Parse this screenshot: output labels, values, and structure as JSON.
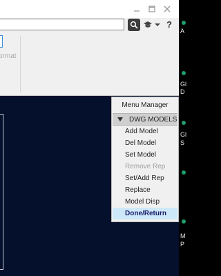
{
  "search": {
    "value": "",
    "placeholder": ""
  },
  "toolbar": {
    "help_label": "?"
  },
  "ribbon": {
    "format_label": "ormat"
  },
  "menu_manager": {
    "title": "Menu Manager",
    "section": "DWG MODELS",
    "items": [
      {
        "label": "Add Model",
        "enabled": true
      },
      {
        "label": "Del Model",
        "enabled": true
      },
      {
        "label": "Set Model",
        "enabled": true
      },
      {
        "label": "Remove Rep",
        "enabled": false
      },
      {
        "label": "Set/Add Rep",
        "enabled": true
      },
      {
        "label": "Replace",
        "enabled": true
      },
      {
        "label": "Model Disp",
        "enabled": true
      },
      {
        "label": "Done/Return",
        "enabled": true,
        "highlighted": true
      }
    ]
  },
  "right_strip": {
    "texts": [
      "A",
      "Gl",
      "D",
      "Gl",
      "S",
      "M",
      "P"
    ]
  },
  "colors": {
    "graphics_background": "#04102c",
    "highlight": "#cde8f8",
    "disabled_text": "#a0a0a0",
    "status_green": "#1e9e6a"
  }
}
